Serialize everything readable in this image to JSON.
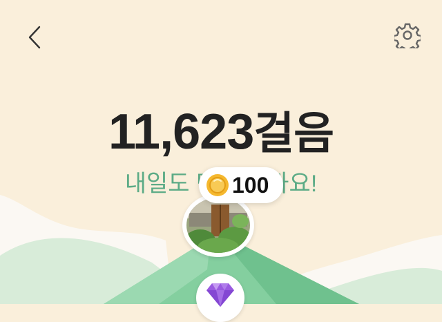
{
  "header": {
    "back_icon": "chevron-left-icon",
    "settings_icon": "gear-icon"
  },
  "main": {
    "step_count": "11,623",
    "step_unit": "걸음",
    "subtitle": "내일도 만나요 봐요!"
  },
  "reward": {
    "coin_icon": "coin-icon",
    "amount": "100"
  },
  "map": {
    "photo_marker": "landmark-photo",
    "gem_icon": "gem-icon"
  },
  "colors": {
    "background": "#faefdb",
    "accent_green": "#5cab86",
    "mountain": "#7ecb9b",
    "gem": "#9a5be0",
    "coin": "#f5b82e"
  }
}
